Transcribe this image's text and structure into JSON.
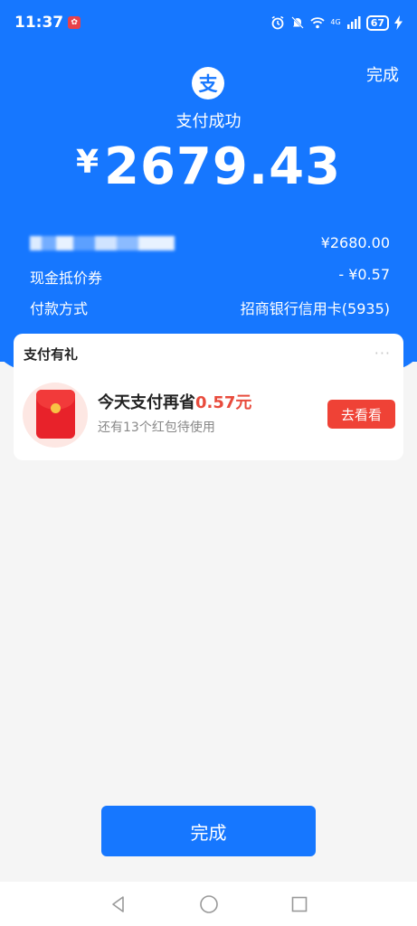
{
  "status_bar": {
    "time": "11:37",
    "notif_icon": "app-notification-icon",
    "network_label": "4G",
    "battery": "67"
  },
  "header": {
    "done_label": "完成",
    "logo_char": "支",
    "success_text": "支付成功",
    "currency_symbol": "¥",
    "amount": "2679.43"
  },
  "details": {
    "original_amount": "¥2680.00",
    "coupon_label": "现金抵价券",
    "coupon_value": "- ¥0.57",
    "method_label": "付款方式",
    "method_value": "招商银行信用卡(5935)"
  },
  "promo_card": {
    "title": "支付有礼",
    "more": "···",
    "headline_prefix": "今天支付再省",
    "headline_amount": "0.57元",
    "subline": "还有13个红包待使用",
    "button": "去看看"
  },
  "footer": {
    "done_button": "完成"
  },
  "colors": {
    "brand_blue": "#1677ff",
    "promo_red": "#ef4236",
    "accent_red_text": "#e84b3c"
  }
}
